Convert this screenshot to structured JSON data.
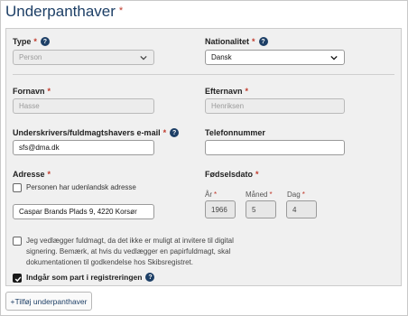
{
  "section": {
    "title": "Underpanthaver",
    "required_marker": "*"
  },
  "form": {
    "type": {
      "label": "Type",
      "required": "*",
      "value": "Person",
      "help_icon": "question-circle-icon"
    },
    "nationality": {
      "label": "Nationalitet",
      "required": "*",
      "value": "Dansk",
      "help_icon": "question-circle-icon"
    },
    "firstname": {
      "label": "Fornavn",
      "required": "*",
      "value": "Hasse"
    },
    "lastname": {
      "label": "Efternavn",
      "required": "*",
      "value": "Henriksen"
    },
    "email": {
      "label": "Underskrivers/fuldmagtshavers e-mail",
      "required": "*",
      "value": "sfs@dma.dk",
      "help_icon": "question-circle-icon"
    },
    "phone": {
      "label": "Telefonnummer",
      "value": ""
    },
    "address": {
      "label": "Adresse",
      "required": "*",
      "foreign_checkbox_label": "Personen har udenlandsk adresse",
      "foreign_checked": false,
      "value": "Caspar Brands Plads 9, 4220 Korsør"
    },
    "birthdate": {
      "label": "Fødselsdato",
      "required": "*",
      "year_label": "År",
      "month_label": "Måned",
      "day_label": "Dag",
      "year": "1966",
      "month": "5",
      "day": "4"
    },
    "power_of_attorney": {
      "checked": false,
      "text": "Jeg vedlægger fuldmagt, da det ikke er muligt at invitere til digital signering. Bemærk, at hvis du vedlægger en papirfuldmagt, skal dokumentationen til godkendelse hos Skibsregistret."
    },
    "party_in_registration": {
      "label": "Indgår som part i registreringen",
      "checked": true,
      "help_icon": "question-circle-icon"
    }
  },
  "actions": {
    "add_label": "+Tilføj underpanthaver"
  }
}
